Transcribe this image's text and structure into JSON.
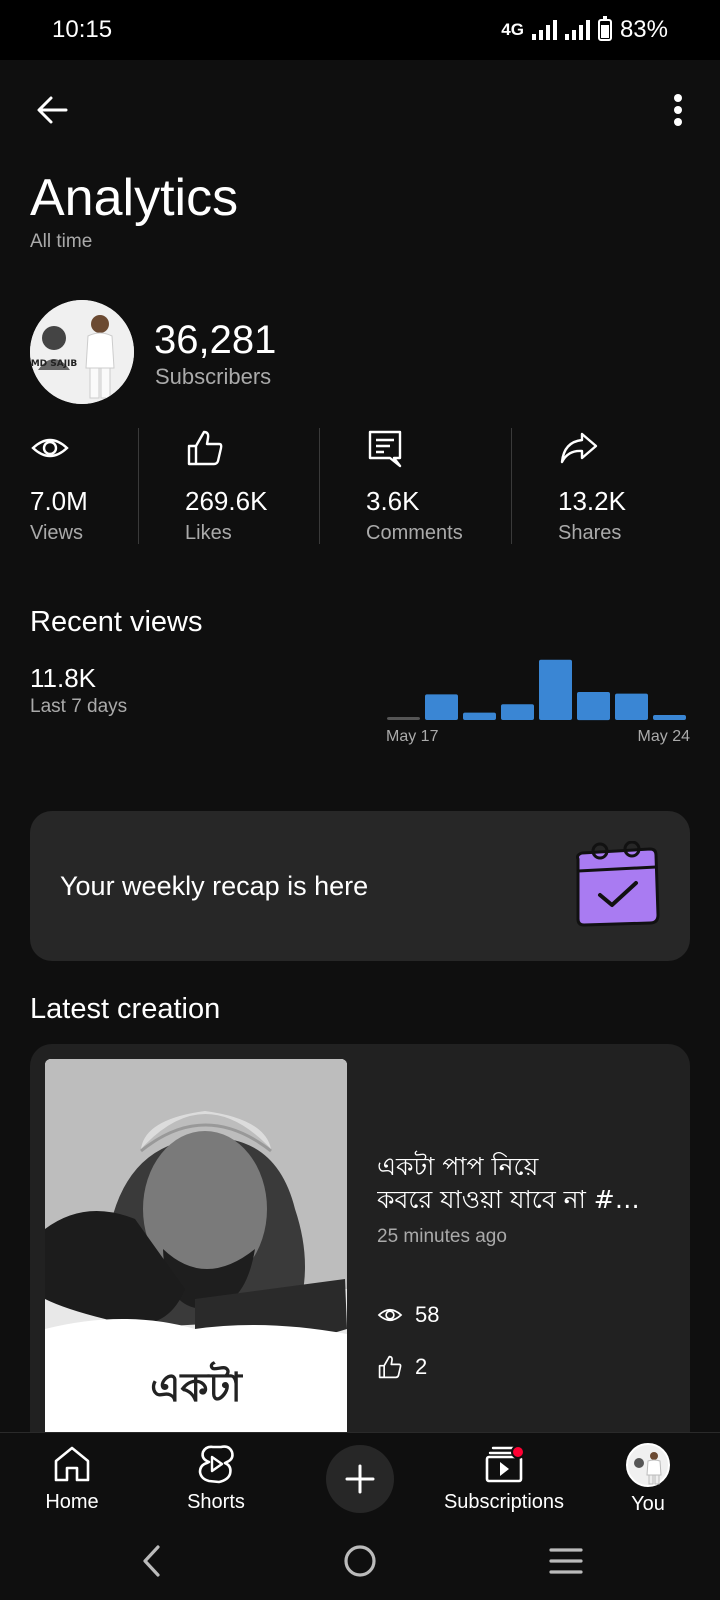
{
  "status": {
    "time": "10:15",
    "network": "4G",
    "battery": "83%"
  },
  "header": {
    "title": "Analytics",
    "subtitle": "All time"
  },
  "channel": {
    "subscribers_value": "36,281",
    "subscribers_label": "Subscribers",
    "avatar_text": "MD SAJIB"
  },
  "stats": [
    {
      "icon": "eye-icon",
      "value": "7.0M",
      "label": "Views"
    },
    {
      "icon": "thumbs-up-icon",
      "value": "269.6K",
      "label": "Likes"
    },
    {
      "icon": "comment-icon",
      "value": "3.6K",
      "label": "Comments"
    },
    {
      "icon": "share-icon",
      "value": "13.2K",
      "label": "Shares"
    }
  ],
  "recent_views": {
    "heading": "Recent views",
    "value": "11.8K",
    "label": "Last 7 days",
    "start_label": "May 17",
    "end_label": "May 24"
  },
  "chart_data": {
    "type": "bar",
    "values": [
      0.3,
      3.1,
      0.9,
      1.9,
      7.3,
      3.4,
      3.2,
      0.6
    ],
    "ylim": [
      0,
      8
    ],
    "color": "#3a86d4",
    "empty_color": "#555555",
    "x_labels": [
      "May 17",
      "May 24"
    ]
  },
  "recap": {
    "text": "Your weekly recap is here",
    "icon": "calendar-check-icon",
    "accent": "#a97bf2"
  },
  "latest": {
    "heading": "Latest creation",
    "title_line1": "একটা পাপ নিয়ে",
    "title_line2": "কবরে যাওয়া যাবে না #…",
    "time": "25 minutes ago",
    "views": "58",
    "likes": "2",
    "thumb_caption": "একটা"
  },
  "nav": {
    "items": [
      {
        "icon": "home-icon",
        "label": "Home"
      },
      {
        "icon": "shorts-icon",
        "label": "Shorts"
      },
      {
        "icon": "plus-icon",
        "label": ""
      },
      {
        "icon": "subscriptions-icon",
        "label": "Subscriptions"
      },
      {
        "icon": "avatar-icon",
        "label": "You"
      }
    ]
  },
  "colors": {
    "background": "#0f0f0f",
    "card": "#212121",
    "bar": "#3a86d4",
    "notification": "#ff0033"
  }
}
